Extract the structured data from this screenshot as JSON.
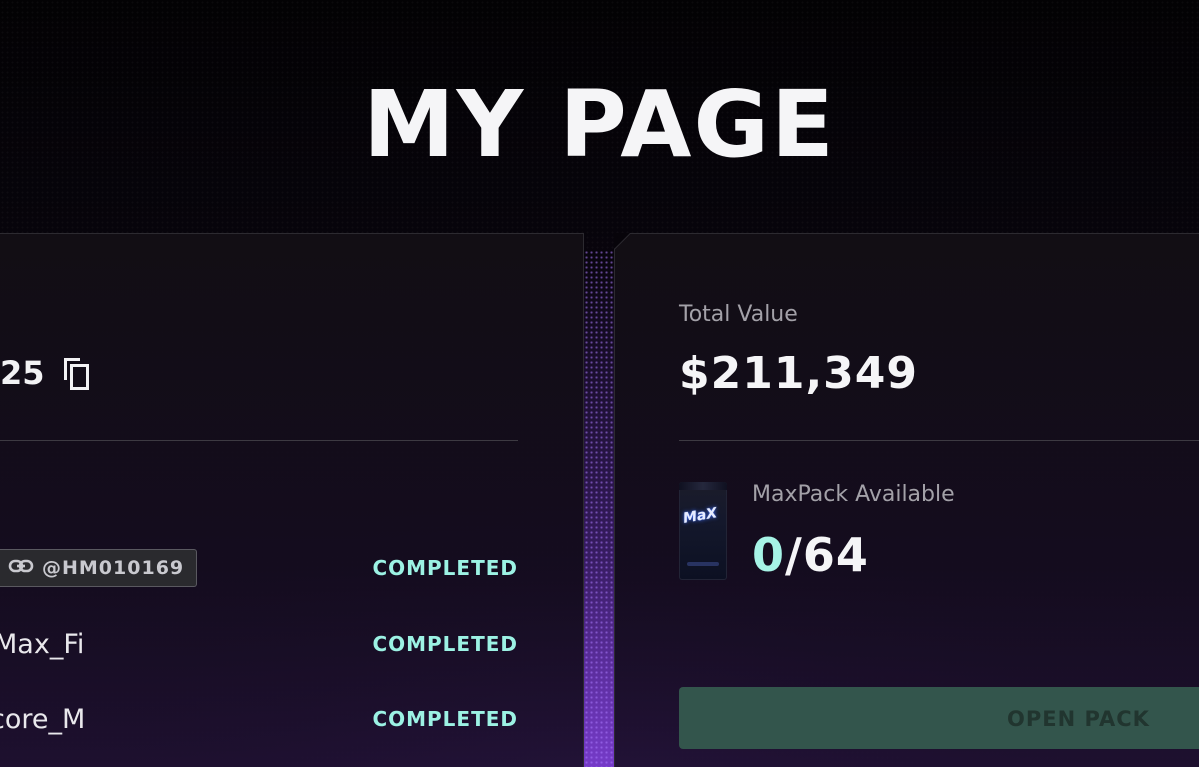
{
  "page": {
    "title": "MY PAGE"
  },
  "left_panel": {
    "id_value": "25",
    "tasks": [
      {
        "name": "",
        "ref_code": "@HM010169",
        "status": "COMPLETED"
      },
      {
        "name": "Max_Fi",
        "status": "COMPLETED"
      },
      {
        "name": "core_M",
        "status": "COMPLETED"
      }
    ]
  },
  "right_panel": {
    "total_label": "Total Value",
    "total_value": "$211,349",
    "pack_label": "MaxPack Available",
    "pack_available": "0",
    "pack_total": "/64",
    "pack_logo_text": "MaX",
    "open_button_label": "OPEN PACK",
    "open_button_enabled": false
  },
  "colors": {
    "accent_teal": "#9cf2e4",
    "button_disabled_bg": "#33554c",
    "background_glow": "#6e37c8"
  },
  "icons": {
    "copy": "copy-icon",
    "link": "link-icon"
  }
}
